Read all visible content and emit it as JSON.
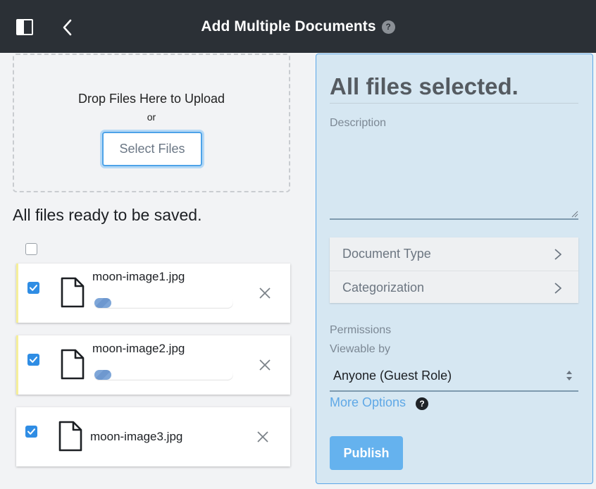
{
  "header": {
    "title": "Add Multiple Documents",
    "help_glyph": "?",
    "sidebar_toggle_icon": "sidebar-toggle-icon",
    "back_icon": "back-chevron-icon"
  },
  "upload": {
    "drop_text": "Drop Files Here to Upload",
    "or_text": "or",
    "select_button": "Select Files"
  },
  "files_section": {
    "title": "All files ready to be saved.",
    "select_all_checked": false,
    "files": [
      {
        "name": "moon-image1.jpg",
        "checked": true,
        "progress": 0.12,
        "pending": true
      },
      {
        "name": "moon-image2.jpg",
        "checked": true,
        "progress": 0.12,
        "pending": true
      },
      {
        "name": "moon-image3.jpg",
        "checked": true,
        "pending": false
      }
    ]
  },
  "details": {
    "title": "All files selected.",
    "description_label": "Description",
    "description_value": "",
    "nav_items": [
      {
        "label": "Document Type"
      },
      {
        "label": "Categorization"
      }
    ],
    "permissions_label": "Permissions",
    "viewable_by_label": "Viewable by",
    "viewable_by_value": "Anyone (Guest Role)",
    "more_options": "More Options",
    "more_options_help": "?",
    "publish_button": "Publish"
  },
  "colors": {
    "topbar": "#2b3036",
    "accent": "#2f8de4",
    "panel_bg": "#d6e7f2",
    "publish": "#65b2ee",
    "link": "#5fa8e6",
    "pending_marker": "#f6ef9a"
  }
}
